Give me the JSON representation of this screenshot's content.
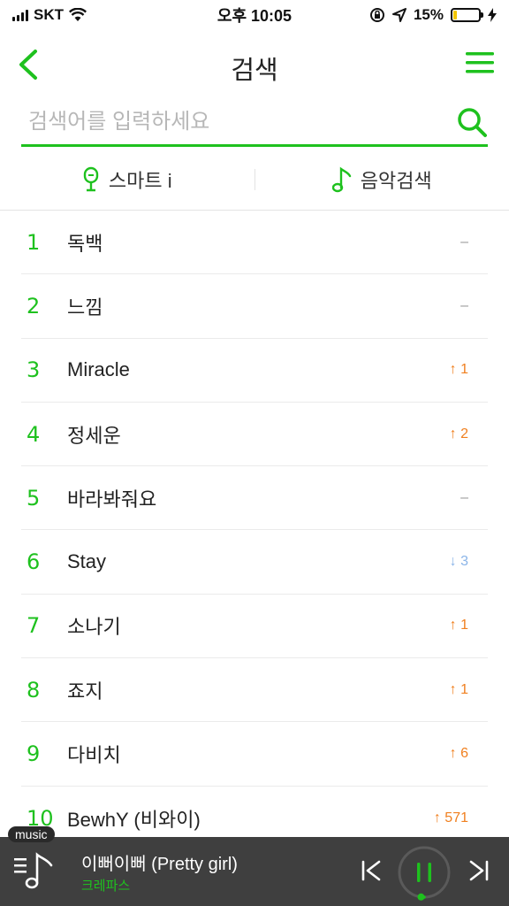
{
  "status_bar": {
    "carrier": "SKT",
    "time": "오후 10:05",
    "battery_percent": "15%",
    "battery_level": 0.15
  },
  "header": {
    "title": "검색"
  },
  "search": {
    "placeholder": "검색어를 입력하세요",
    "value": ""
  },
  "tabs": [
    {
      "label": "스마트 i",
      "icon": "microphone-icon"
    },
    {
      "label": "음악검색",
      "icon": "music-note-icon"
    }
  ],
  "ranking": [
    {
      "rank": "1",
      "title": "독백",
      "change": "–",
      "direction": "same"
    },
    {
      "rank": "2",
      "title": "느낌",
      "change": "–",
      "direction": "same"
    },
    {
      "rank": "3",
      "title": "Miracle",
      "change": "1",
      "direction": "up"
    },
    {
      "rank": "4",
      "title": "정세운",
      "change": "2",
      "direction": "up"
    },
    {
      "rank": "5",
      "title": "바라봐줘요",
      "change": "–",
      "direction": "same"
    },
    {
      "rank": "6",
      "title": "Stay",
      "change": "3",
      "direction": "down"
    },
    {
      "rank": "7",
      "title": "소나기",
      "change": "1",
      "direction": "up"
    },
    {
      "rank": "8",
      "title": "죠지",
      "change": "1",
      "direction": "up"
    },
    {
      "rank": "9",
      "title": "다비치",
      "change": "6",
      "direction": "up"
    },
    {
      "rank": "10",
      "title": "BewhY (비와이)",
      "change": "571",
      "direction": "up"
    }
  ],
  "player": {
    "tag": "music",
    "song_title": "이뻐이뻐 (Pretty girl)",
    "artist": "크레파스",
    "progress": 0.02
  },
  "colors": {
    "accent": "#1ec11e",
    "up": "#f08020",
    "down": "#8ab4e8",
    "player_bg": "#3f3f3f"
  }
}
